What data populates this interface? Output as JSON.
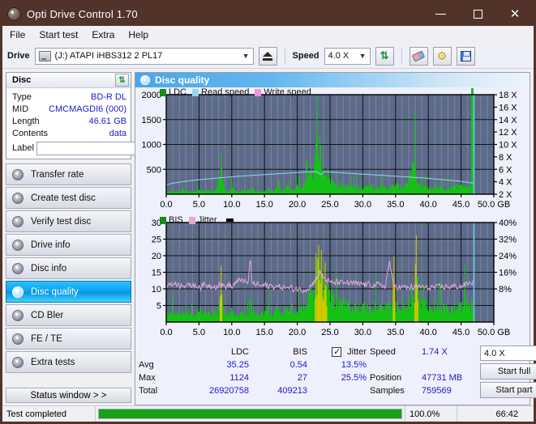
{
  "window": {
    "title": "Opti Drive Control 1.70"
  },
  "titlebar_buttons": {
    "minimize": "minimize-button",
    "maximize": "maximize-button",
    "close": "close-button"
  },
  "menu": {
    "items": [
      "File",
      "Start test",
      "Extra",
      "Help"
    ]
  },
  "toolbar": {
    "drive_label": "Drive",
    "drive_value": "(J:)  ATAPI iHBS312  2 PL17",
    "speed_label": "Speed",
    "speed_value": "4.0 X",
    "eject_icon": "eject-icon",
    "refresh_icon": "refresh-icon",
    "eraser_icon": "eraser-icon",
    "gear_icon": "gear-icon",
    "save_icon": "save-icon"
  },
  "disc_panel": {
    "title": "Disc",
    "refresh_icon": "refresh-icon",
    "rows": [
      {
        "key": "Type",
        "value": "BD-R DL"
      },
      {
        "key": "MID",
        "value": "CMCMAGDI6 (000)"
      },
      {
        "key": "Length",
        "value": "46.61 GB"
      },
      {
        "key": "Contents",
        "value": "data"
      }
    ],
    "label_key": "Label",
    "label_value": "",
    "label_placeholder": "",
    "disc_icon": "disc-icon"
  },
  "sidebar": {
    "items": [
      {
        "label": "Transfer rate",
        "active": false
      },
      {
        "label": "Create test disc",
        "active": false
      },
      {
        "label": "Verify test disc",
        "active": false
      },
      {
        "label": "Drive info",
        "active": false
      },
      {
        "label": "Disc info",
        "active": false
      },
      {
        "label": "Disc quality",
        "active": true
      },
      {
        "label": "CD Bler",
        "active": false
      },
      {
        "label": "FE / TE",
        "active": false
      },
      {
        "label": "Extra tests",
        "active": false
      }
    ],
    "status_window": "Status window > >"
  },
  "panel": {
    "title": "Disc quality",
    "icon": "disc-quality-icon"
  },
  "stats": {
    "col_ldc": "LDC",
    "col_bis": "BIS",
    "col_jitter": "Jitter",
    "jitter_checked": true,
    "rows": [
      {
        "label": "Avg",
        "ldc": "35.25",
        "bis": "0.54",
        "jitter": "13.5%"
      },
      {
        "label": "Max",
        "ldc": "1124",
        "bis": "27",
        "jitter": "25.5%"
      },
      {
        "label": "Total",
        "ldc": "26920758",
        "bis": "409213",
        "jitter": ""
      }
    ],
    "speed_label": "Speed",
    "speed_value": "1.74 X",
    "position_label": "Position",
    "position_value": "47731 MB",
    "samples_label": "Samples",
    "samples_value": "759569",
    "speed_select": "4.0 X",
    "start_full": "Start full",
    "start_part": "Start part"
  },
  "statusbar": {
    "message": "Test completed",
    "progress_pct": "100.0%",
    "progress_value": 100,
    "elapsed": "66:42"
  },
  "colors": {
    "ldc": "#16c116",
    "bis": "#16c116",
    "read_speed": "#8fd8f5",
    "write_speed": "#f58fe0",
    "jitter": "#e3a8d8",
    "plot_bg": "#5d6b8a",
    "accent": "#0aa3ef",
    "value_text": "#1a1ad0",
    "progress": "#16a116"
  },
  "chart_data": [
    {
      "type": "area",
      "name": "ldc-chart",
      "title": "",
      "xlabel": "GB",
      "ylabel": "",
      "xlim": [
        0,
        50
      ],
      "ylim": [
        0,
        2000
      ],
      "y2lim": [
        0,
        18
      ],
      "y2label": "X",
      "xticks": [
        "0.0",
        "5.0",
        "10.0",
        "15.0",
        "20.0",
        "25.0",
        "30.0",
        "35.0",
        "40.0",
        "45.0",
        "50.0 GB"
      ],
      "yticks": [
        "2000",
        "1500",
        "1000",
        "500"
      ],
      "y2ticks": [
        "18 X",
        "16 X",
        "14 X",
        "12 X",
        "10 X",
        "8 X",
        "6 X",
        "4 X",
        "2 X"
      ],
      "legend": [
        {
          "label": "LDC",
          "color": "#1a8a1a"
        },
        {
          "label": "Read speed",
          "color": "#8fd8f5"
        },
        {
          "label": "Write speed",
          "color": "#f58fe0"
        }
      ],
      "series": [
        {
          "name": "LDC",
          "color": "#16c116",
          "x": [
            0.0,
            0.5,
            1.0,
            1.5,
            2.0,
            2.5,
            3.0,
            3.5,
            4.0,
            4.5,
            5.0,
            5.5,
            6.0,
            6.5,
            7.0,
            7.5,
            8.0,
            8.3,
            8.6,
            9.0,
            9.5,
            10.0,
            10.5,
            11.0,
            11.5,
            12.0,
            12.5,
            13.0,
            13.5,
            14.0,
            14.5,
            15.0,
            15.5,
            16.0,
            16.5,
            17.0,
            17.5,
            18.0,
            18.5,
            19.0,
            19.5,
            20.0,
            20.5,
            21.0,
            21.5,
            22.0,
            22.5,
            23.0,
            23.3,
            23.6,
            24.0,
            24.5,
            25.0,
            25.5,
            26.0,
            26.5,
            27.0,
            27.5,
            28.0,
            28.5,
            29.0,
            29.5,
            30.0,
            31.0,
            32.0,
            33.0,
            34.0,
            35.0,
            36.0,
            37.0,
            37.8,
            38.2,
            39.0,
            40.0,
            41.0,
            42.0,
            43.0,
            44.0,
            45.0,
            45.5,
            46.0,
            46.5,
            46.9
          ],
          "values": [
            40,
            55,
            70,
            60,
            50,
            95,
            60,
            70,
            55,
            60,
            110,
            60,
            70,
            65,
            60,
            90,
            300,
            870,
            300,
            75,
            65,
            150,
            70,
            60,
            90,
            60,
            75,
            130,
            60,
            70,
            65,
            60,
            120,
            60,
            70,
            230,
            80,
            75,
            300,
            70,
            80,
            180,
            120,
            230,
            260,
            420,
            560,
            1020,
            1124,
            700,
            620,
            460,
            330,
            250,
            230,
            200,
            180,
            170,
            160,
            150,
            140,
            160,
            130,
            180,
            120,
            160,
            140,
            200,
            150,
            330,
            620,
            200,
            160,
            130,
            150,
            110,
            120,
            140,
            300,
            150,
            200,
            120
          ]
        },
        {
          "name": "Read speed",
          "color": "#8fd8f5",
          "x": [
            0.0,
            1.0,
            2.0,
            3.0,
            4.0,
            5.0,
            6.0,
            7.0,
            8.0,
            9.0,
            10.0,
            11.0,
            12.0,
            13.0,
            14.0,
            15.0,
            16.0,
            17.0,
            18.0,
            19.0,
            20.0,
            21.0,
            22.0,
            23.0,
            23.5,
            24.0,
            25.0,
            26.0,
            27.0,
            28.0,
            29.0,
            30.0,
            31.0,
            32.0,
            33.0,
            34.0,
            35.0,
            36.0,
            37.0,
            38.0,
            39.0,
            40.0,
            41.0,
            42.0,
            43.0,
            44.0,
            45.0,
            46.0,
            46.8,
            46.9
          ],
          "values_x": [
            1.72,
            2.0,
            2.18,
            2.35,
            2.5,
            2.62,
            2.75,
            2.85,
            2.95,
            3.05,
            3.15,
            3.25,
            3.32,
            3.4,
            3.48,
            3.55,
            3.62,
            3.7,
            3.78,
            3.85,
            3.92,
            3.98,
            4.02,
            4.05,
            3.55,
            4.05,
            4.0,
            3.92,
            3.85,
            3.78,
            3.7,
            3.62,
            3.55,
            3.48,
            3.4,
            3.32,
            3.25,
            3.18,
            3.1,
            3.02,
            2.95,
            2.85,
            2.75,
            2.65,
            2.55,
            2.45,
            2.32,
            2.12,
            2.0,
            18.0
          ]
        }
      ]
    },
    {
      "type": "area",
      "name": "bis-jitter-chart",
      "title": "",
      "xlabel": "GB",
      "xlim": [
        0,
        50
      ],
      "ylim": [
        0,
        30
      ],
      "y2lim": [
        0,
        40
      ],
      "xticks": [
        "0.0",
        "5.0",
        "10.0",
        "15.0",
        "20.0",
        "25.0",
        "30.0",
        "35.0",
        "40.0",
        "45.0",
        "50.0 GB"
      ],
      "yticks": [
        "30",
        "25",
        "20",
        "15",
        "10",
        "5"
      ],
      "y2ticks": [
        "40%",
        "32%",
        "24%",
        "16%",
        "8%"
      ],
      "legend": [
        {
          "label": "BIS",
          "color": "#1a8a1a"
        },
        {
          "label": "Jitter",
          "color": "#e3a8d8"
        }
      ],
      "series": [
        {
          "name": "BIS",
          "color": "#16c116",
          "x": [
            0.0,
            0.5,
            1.0,
            1.5,
            2.0,
            2.5,
            3.0,
            3.5,
            4.0,
            4.5,
            5.0,
            5.5,
            6.0,
            6.5,
            7.0,
            7.5,
            8.0,
            8.3,
            8.6,
            9.0,
            9.5,
            10.0,
            10.5,
            11.0,
            11.5,
            12.0,
            12.5,
            13.0,
            13.5,
            14.0,
            14.5,
            15.0,
            15.5,
            16.0,
            16.5,
            17.0,
            17.5,
            18.0,
            18.5,
            19.0,
            19.5,
            20.0,
            20.5,
            21.0,
            21.5,
            22.0,
            22.5,
            23.0,
            23.3,
            23.6,
            24.0,
            24.5,
            25.0,
            25.5,
            26.0,
            26.5,
            27.0,
            27.5,
            28.0,
            28.5,
            29.0,
            29.5,
            30.0,
            31.0,
            32.0,
            33.0,
            34.0,
            35.0,
            36.0,
            37.0,
            37.8,
            38.2,
            39.0,
            40.0,
            41.0,
            42.0,
            43.0,
            44.0,
            45.0,
            45.5,
            46.0,
            46.5,
            46.9
          ],
          "values": [
            2.2,
            3.0,
            2.6,
            2.4,
            2.8,
            4.6,
            2.5,
            3.0,
            2.6,
            2.4,
            4.2,
            2.6,
            3.0,
            2.8,
            2.6,
            3.6,
            5.0,
            7.5,
            4.0,
            2.8,
            2.6,
            4.4,
            2.8,
            2.5,
            3.4,
            2.6,
            3.0,
            4.6,
            2.6,
            2.8,
            2.7,
            2.6,
            4.0,
            2.6,
            2.8,
            5.2,
            3.0,
            2.8,
            5.5,
            2.8,
            3.0,
            4.0,
            4.6,
            6.0,
            7.5,
            9.5,
            12.0,
            16.0,
            18.5,
            15.0,
            13.0,
            11.0,
            9.0,
            7.5,
            6.8,
            6.2,
            5.8,
            5.4,
            5.0,
            4.8,
            4.6,
            4.4,
            5.2,
            4.4,
            6.0,
            4.2,
            5.2,
            4.8,
            6.5,
            5.0,
            9.0,
            13.0,
            6.0,
            5.0,
            4.4,
            4.8,
            4.0,
            4.4,
            4.8,
            8.0,
            5.0,
            6.0,
            4.2
          ]
        },
        {
          "name": "Jitter",
          "color": "#e3a8d8",
          "x": [
            0.0,
            0.4,
            0.8,
            1.2,
            1.6,
            2.0,
            2.4,
            2.8,
            3.2,
            3.6,
            4.0,
            4.4,
            4.8,
            5.2,
            5.6,
            6.0,
            6.4,
            6.8,
            7.2,
            7.6,
            8.0,
            8.4,
            8.8,
            9.2,
            9.6,
            10.0,
            10.4,
            10.8,
            11.2,
            11.6,
            12.0,
            12.4,
            12.8,
            13.0,
            13.4,
            13.8,
            14.2,
            14.6,
            15.0,
            15.4,
            15.8,
            16.2,
            16.6,
            17.0,
            17.4,
            17.8,
            18.2,
            18.6,
            19.0,
            19.4,
            19.8,
            20.2,
            20.6,
            21.0,
            21.4,
            21.8,
            22.2,
            22.6,
            23.0,
            23.4,
            23.8,
            24.2,
            24.6,
            25.0,
            25.6,
            26.2,
            26.8,
            27.4,
            28.0,
            28.6,
            29.2,
            29.8,
            30.4,
            31.0,
            31.6,
            32.2,
            32.8,
            33.4,
            34.0,
            34.6,
            35.0,
            35.6,
            36.2,
            36.8,
            37.4,
            38.0,
            38.6,
            39.2,
            39.8,
            40.4,
            41.0,
            41.6,
            42.2,
            42.8,
            43.4,
            44.0,
            44.6,
            45.2,
            45.8,
            46.4,
            46.9
          ],
          "values": [
            11.0,
            11.5,
            11.0,
            12.2,
            11.3,
            10.8,
            11.6,
            10.9,
            11.2,
            10.7,
            11.4,
            10.6,
            11.0,
            10.5,
            11.3,
            10.8,
            11.2,
            10.6,
            11.1,
            10.4,
            11.5,
            10.9,
            11.0,
            10.6,
            11.4,
            10.3,
            11.8,
            12.0,
            12.6,
            13.0,
            12.0,
            11.4,
            19.2,
            12.5,
            11.2,
            11.6,
            11.0,
            10.8,
            11.4,
            10.6,
            11.2,
            10.5,
            11.0,
            10.4,
            10.8,
            10.2,
            10.7,
            10.0,
            10.4,
            9.9,
            10.2,
            9.8,
            9.6,
            9.8,
            10.0,
            10.5,
            11.2,
            12.5,
            14.2,
            14.8,
            13.8,
            13.0,
            12.4,
            11.8,
            11.9,
            12.2,
            11.6,
            12.0,
            11.5,
            11.8,
            11.4,
            11.6,
            11.2,
            11.5,
            11.0,
            11.3,
            10.8,
            11.0,
            18.5,
            11.2,
            10.8,
            10.4,
            10.6,
            10.2,
            10.5,
            10.3,
            10.8,
            10.5,
            10.2,
            10.6,
            10.3,
            10.7,
            10.4,
            10.8,
            10.5,
            10.9,
            10.6,
            11.0,
            11.4,
            11.8,
            12.0
          ]
        }
      ]
    }
  ]
}
